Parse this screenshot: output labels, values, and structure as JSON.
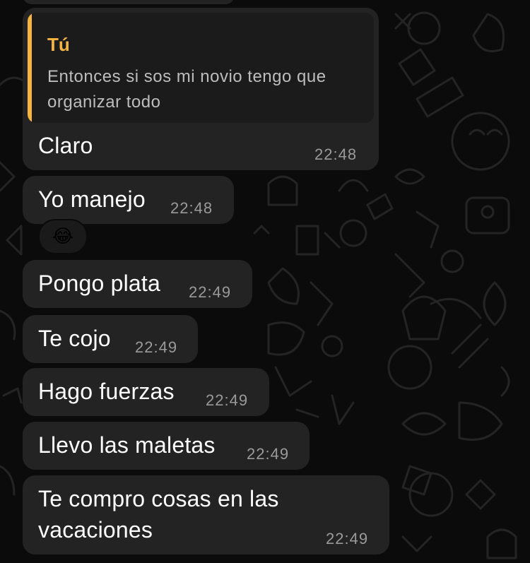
{
  "messages": [
    {
      "quote": {
        "author": "Tú",
        "text": "Entonces si sos mi novio tengo que organizar todo"
      },
      "text": "Claro",
      "time": "22:48"
    },
    {
      "text": "Yo manejo",
      "time": "22:48",
      "reaction": "😂"
    },
    {
      "text": "Pongo plata",
      "time": "22:49"
    },
    {
      "text": "Te cojo",
      "time": "22:49"
    },
    {
      "text": "Hago fuerzas",
      "time": "22:49"
    },
    {
      "text": "Llevo las maletas",
      "time": "22:49"
    },
    {
      "text": "Te compro cosas en las vacaciones",
      "time": "22:49"
    }
  ],
  "colors": {
    "background": "#0b0b0b",
    "bubble": "#232323",
    "quote_accent": "#f6b63e",
    "timestamp": "#9a9a9a"
  },
  "icons": {
    "reaction": "tears-of-joy-emoji"
  }
}
